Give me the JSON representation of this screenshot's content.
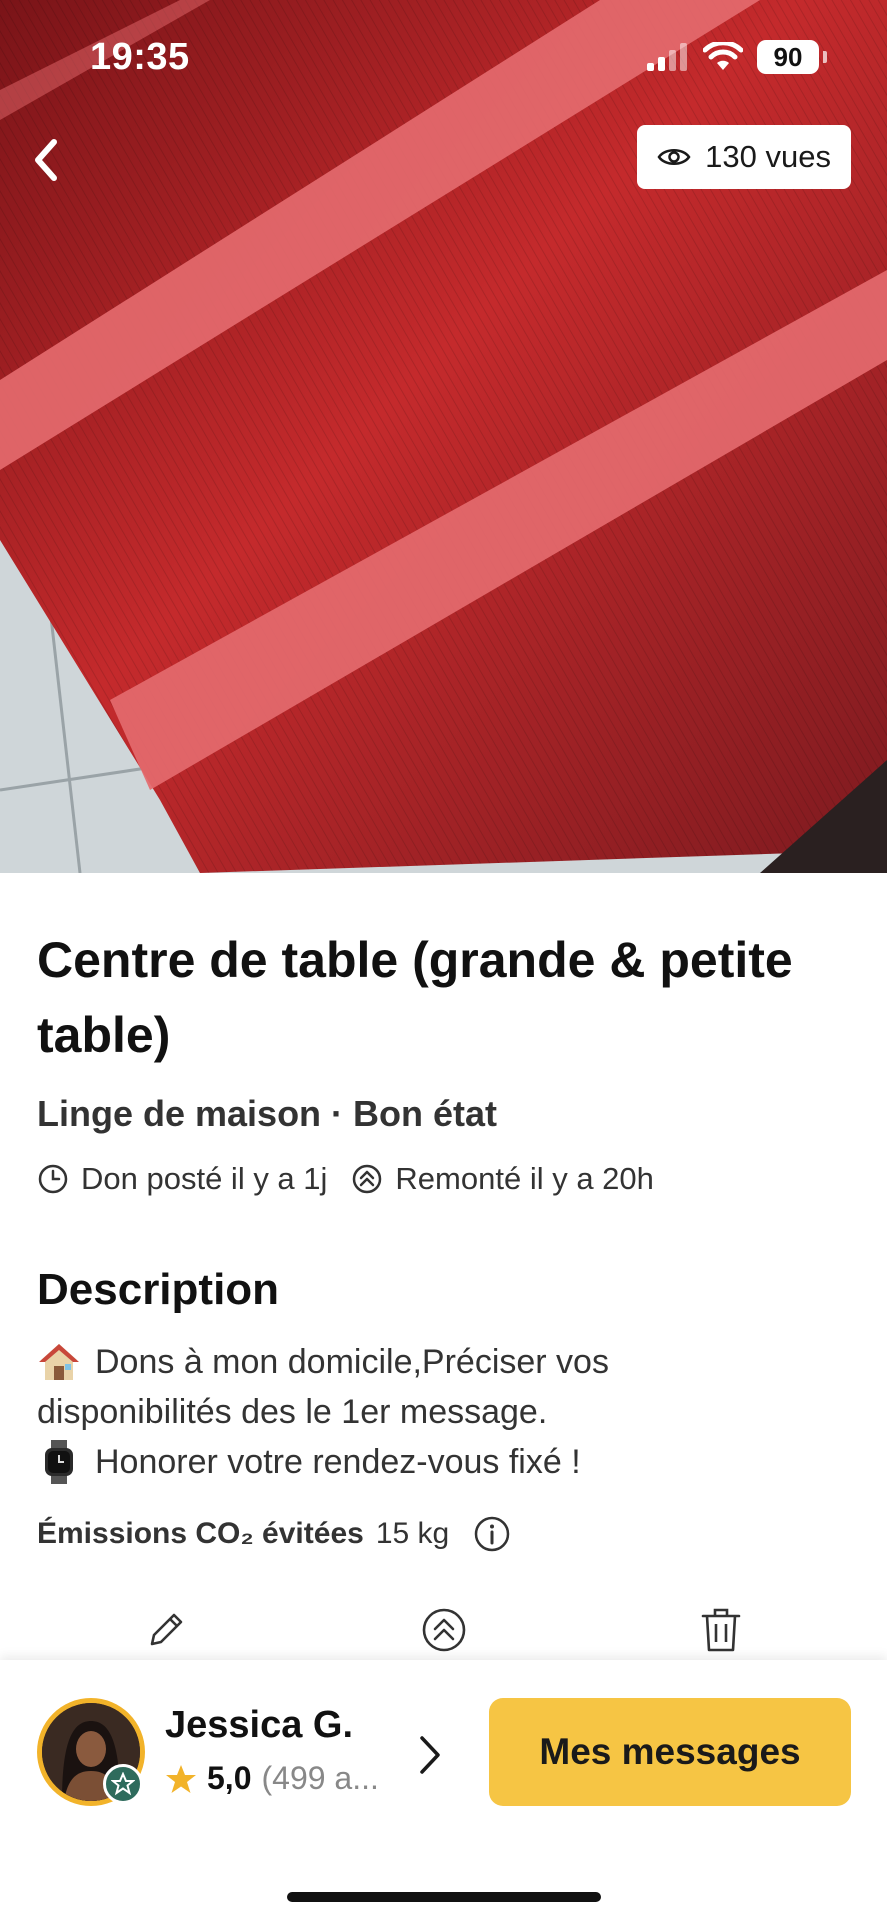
{
  "status_bar": {
    "time": "19:35",
    "battery": "90"
  },
  "photo": {
    "views_label": "130 vues"
  },
  "listing": {
    "title": "Centre de table (grande & petite table)",
    "subtitle": "Linge de maison · Bon état",
    "posted": "Don posté il y a 1j",
    "bumped": "Remonté il y a 20h"
  },
  "description": {
    "heading": "Description",
    "line1": "Dons à mon domicile,Préciser vos",
    "line2": "disponibilités des le 1er message.",
    "line3": "Honorer votre rendez-vous fixé !"
  },
  "co2": {
    "label": "Émissions CO₂ évitées",
    "value": "15 kg"
  },
  "seller": {
    "name": "Jessica G.",
    "rating": "5,0",
    "reviews": "(499 a..."
  },
  "actions": {
    "messages_label": "Mes messages"
  },
  "colors": {
    "accent": "#f6c544",
    "fabric": "#8f1e22",
    "stripe": "#e46a6e"
  },
  "icons": [
    "back-icon",
    "eye-icon",
    "clock-icon",
    "bump-icon",
    "house-emoji-icon",
    "watch-emoji-icon",
    "info-icon",
    "edit-icon",
    "bump-action-icon",
    "trash-icon",
    "star-icon",
    "chevron-right-icon",
    "verified-icon"
  ]
}
